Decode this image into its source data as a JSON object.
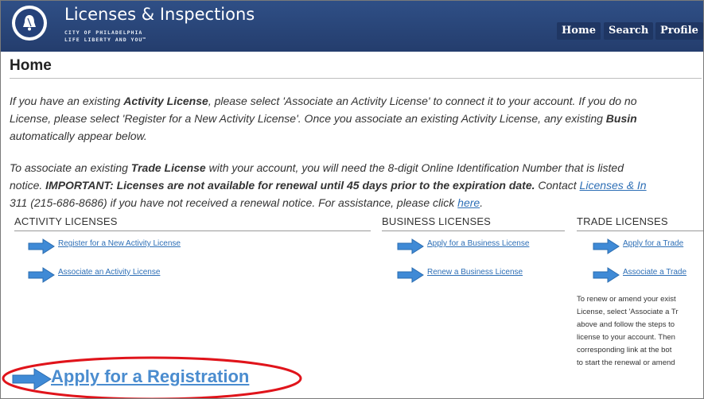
{
  "header": {
    "title": "Licenses & Inspections",
    "subtitle_1": "CITY OF PHILADELPHIA",
    "subtitle_2": "LIFE LIBERTY AND YOU™",
    "nav": [
      "Home",
      "Search",
      "Profile"
    ],
    "bg_color": "#2a4677"
  },
  "page_title": "Home",
  "intro": {
    "line1_a": "If you have an existing ",
    "line1_b": "Activity License",
    "line1_c": ", please select 'Associate an Activity License' to connect it to your account. If you do no",
    "line2_a": "License, please select 'Register for a New Activity License'. Once you associate an existing Activity License, any existing ",
    "line2_b": "Busin",
    "line3": "automatically appear below."
  },
  "trade_note": {
    "line1_a": "To associate an existing ",
    "line1_b": "Trade License",
    "line1_c": " with your account, you will need the 8-digit Online Identification Number that is listed",
    "line2_a": "notice. ",
    "line2_b": "IMPORTANT: Licenses are not available for renewal until 45 days prior to the expiration date.",
    "line2_c": " Contact ",
    "line2_link": "Licenses & In",
    "line3_a": "311 (215-686-8686) if you have not received a renewal notice. For assistance, please click ",
    "line3_link": "here",
    "line3_b": "."
  },
  "sections": {
    "activity": {
      "heading": "ACTIVITY LICENSES",
      "links": [
        "Register for a New Activity License",
        "Associate an Activity License"
      ]
    },
    "business": {
      "heading": "BUSINESS LICENSES",
      "links": [
        "Apply for a Business License",
        "Renew a Business License"
      ]
    },
    "trade": {
      "heading": "TRADE LICENSES",
      "links": [
        "Apply for a Trade",
        "Associate a Trade"
      ],
      "help": [
        "To renew or amend your exist",
        "License, select 'Associate a Tr",
        "above and follow the steps to",
        "license to your account. Then",
        "corresponding link at the bot",
        "to start the renewal or amend"
      ]
    }
  },
  "highlight": {
    "label": "Apply for a Registration",
    "ring_color": "#e0141b"
  },
  "colors": {
    "link": "#2e6fb6",
    "arrow": "#3f8ad6"
  },
  "icons": [
    "liberty-bell-logo-icon",
    "arrow-right-icon"
  ]
}
